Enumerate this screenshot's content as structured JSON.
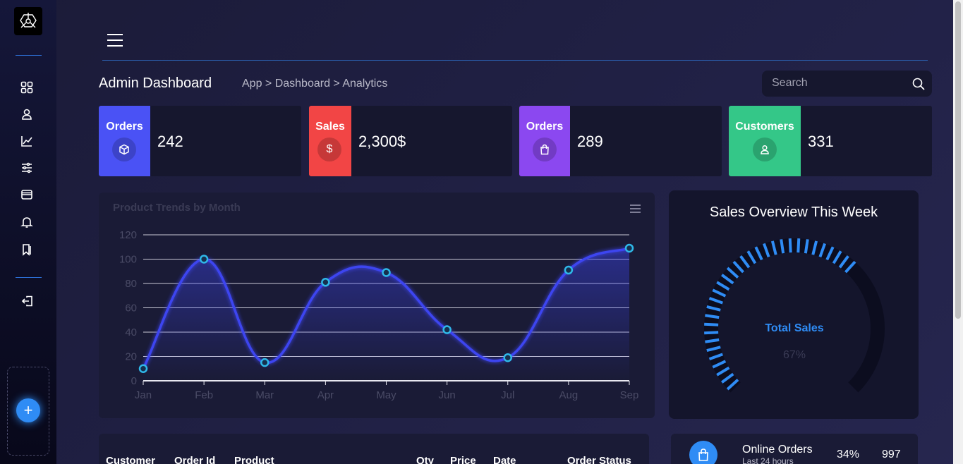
{
  "header": {
    "title": "Admin Dashboard",
    "breadcrumb": "App > Dashboard > Analytics",
    "search_placeholder": "Search"
  },
  "sidebar": {
    "icons": [
      "dashboard-grid-icon",
      "user-icon",
      "chart-line-icon",
      "sliders-icon",
      "browser-window-icon",
      "bell-icon",
      "bookmarks-icon",
      "logout-icon"
    ],
    "add_label": "+"
  },
  "stats": [
    {
      "label": "Orders",
      "value": "242",
      "color": "#4a52f5",
      "icon": "box-icon"
    },
    {
      "label": "Sales",
      "value": "2,300$",
      "color": "#f24545",
      "icon": "dollar-icon"
    },
    {
      "label": "Orders",
      "value": "289",
      "color": "#8b48f0",
      "icon": "bag-icon"
    },
    {
      "label": "Customers",
      "value": "331",
      "color": "#34c788",
      "icon": "user-icon"
    }
  ],
  "chart_data": {
    "type": "line",
    "title": "Product Trends by Month",
    "categories": [
      "Jan",
      "Feb",
      "Mar",
      "Apr",
      "May",
      "Jun",
      "Jul",
      "Aug",
      "Sep"
    ],
    "series": [
      {
        "values": [
          10,
          100,
          15,
          81,
          89,
          42,
          19,
          91,
          109
        ]
      }
    ],
    "yticks": [
      "0",
      "20",
      "40",
      "60",
      "80",
      "100",
      "120"
    ],
    "ylim": [
      0,
      120
    ],
    "grid": true,
    "line_color": "#3d45f0",
    "point_color": "#2fb8e8"
  },
  "gauge": {
    "title": "Sales Overview This Week",
    "label": "Total Sales",
    "value_text": "67%",
    "percent": 67,
    "color": "#2f8cf5"
  },
  "table": {
    "headers": [
      "Customer",
      "Order Id",
      "Product",
      "Qty",
      "Price",
      "Date",
      "Order Status"
    ]
  },
  "online_orders": {
    "title": "Online Orders",
    "subtitle": "Last 24 hours",
    "percent": "34%",
    "count": "997"
  }
}
